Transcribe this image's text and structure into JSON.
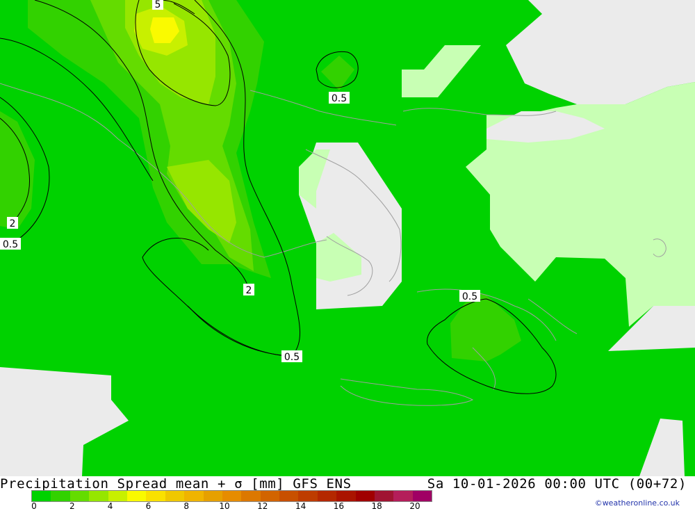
{
  "map": {
    "contour_labels": [
      {
        "value": "5"
      },
      {
        "value": "0.5"
      },
      {
        "value": "2"
      },
      {
        "value": "0.5"
      },
      {
        "value": "2"
      },
      {
        "value": "0.5"
      },
      {
        "value": "0.5"
      }
    ]
  },
  "footer": {
    "title": "Precipitation Spread mean + σ [mm] GFS ENS",
    "datetime": "Sa 10-01-2026 00:00 UTC (00+72)",
    "credit": "©weatheronline.co.uk"
  },
  "legend": {
    "colors": [
      "#00d200",
      "#32d200",
      "#64dc00",
      "#96e600",
      "#c8f000",
      "#fafa00",
      "#fae100",
      "#f0c800",
      "#f0b400",
      "#e6a000",
      "#e68c00",
      "#dc7800",
      "#d26400",
      "#c85000",
      "#be3c00",
      "#b42800",
      "#aa1400",
      "#a00000",
      "#a01432",
      "#b41e5a",
      "#a00064"
    ],
    "tick_labels": [
      "0",
      "2",
      "4",
      "6",
      "8",
      "10",
      "12",
      "14",
      "16",
      "18",
      "20"
    ]
  }
}
